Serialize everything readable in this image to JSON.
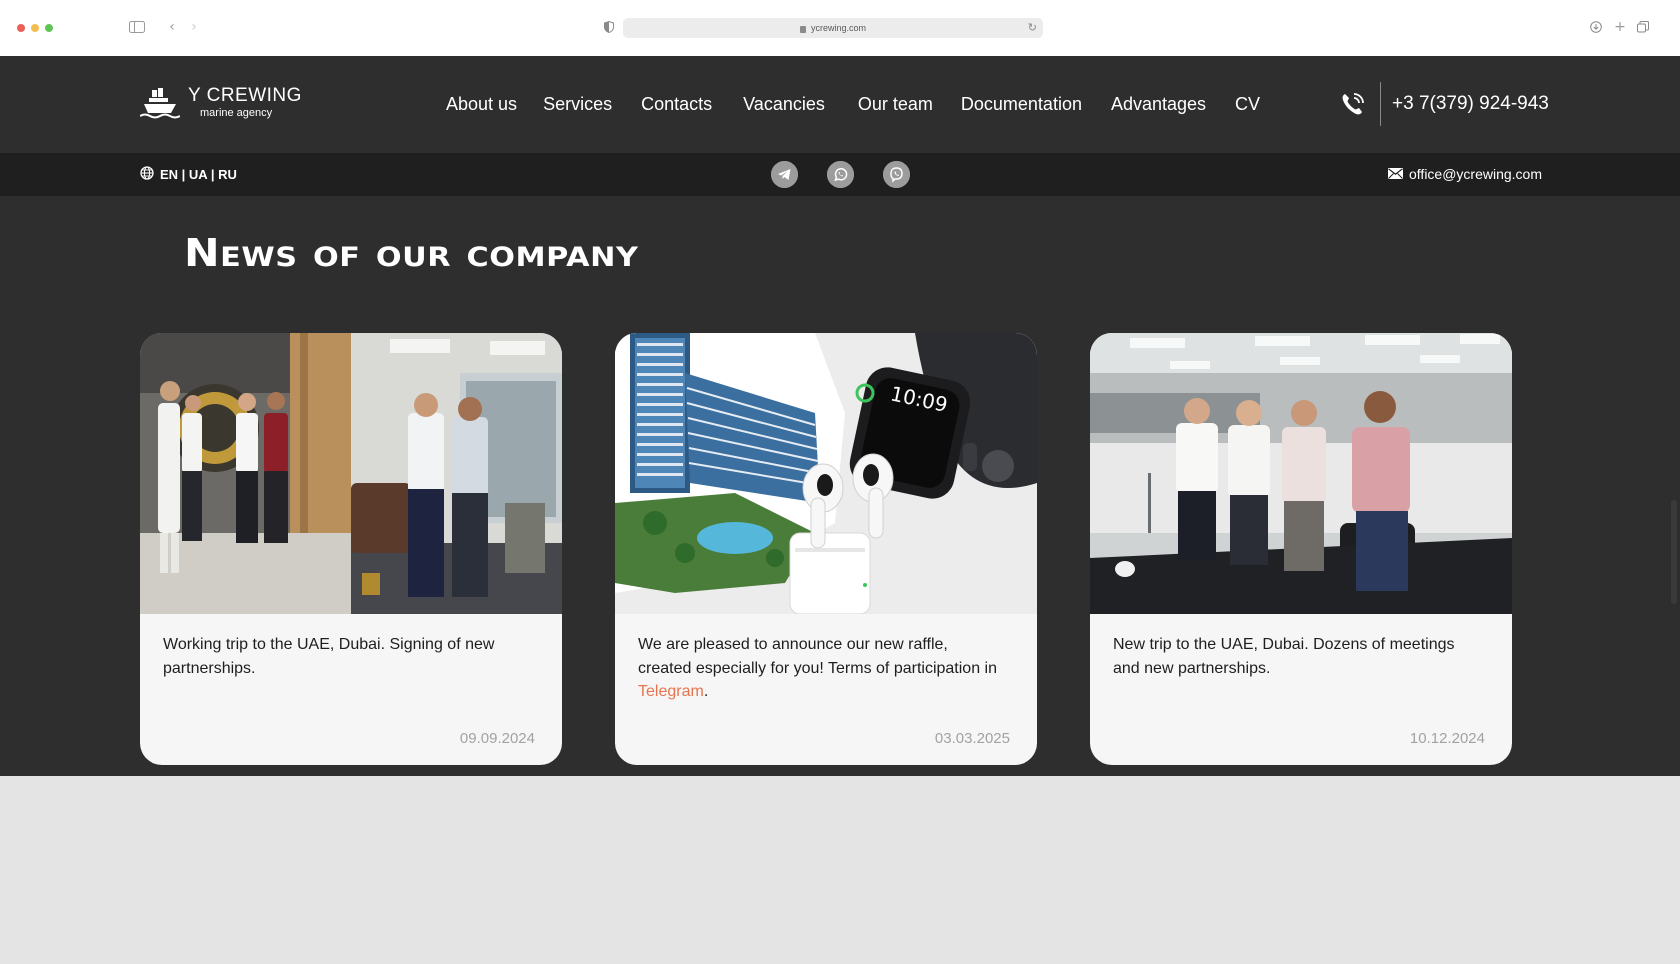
{
  "browser": {
    "url": "ycrewing.com"
  },
  "logo": {
    "title": "Y CREWING",
    "subtitle": "marine agency"
  },
  "nav": {
    "items": [
      {
        "label": "About us"
      },
      {
        "label": "Services"
      },
      {
        "label": "Contacts"
      },
      {
        "label": "Vacancies"
      },
      {
        "label": "Our team"
      },
      {
        "label": "Documentation"
      },
      {
        "label": "Advantages"
      },
      {
        "label": "CV"
      }
    ]
  },
  "contact": {
    "phone": "+3 7(379) 924-943",
    "email": "office@ycrewing.com"
  },
  "languages": {
    "label": "EN | UA | RU"
  },
  "socials": [
    "telegram-icon",
    "whatsapp-icon",
    "viber-icon"
  ],
  "news": {
    "heading": "News of our company",
    "cards": [
      {
        "text": "Working trip to the UAE, Dubai. Signing of new partnerships.",
        "date": "09.09.2024"
      },
      {
        "text_before": "We are pleased to announce our new raffle, created especially for you! Terms of participation in ",
        "link": "Telegram",
        "text_after": ".",
        "date": "03.03.2025"
      },
      {
        "text": "New trip to the UAE, Dubai. Dozens of meetings and new partnerships.",
        "date": "10.12.2024"
      }
    ]
  },
  "colors": {
    "background": "#2e2e2e",
    "subbar": "#1f1f1f",
    "card": "#f6f6f6",
    "link_accent": "#e8744f",
    "date": "#a2a2a2"
  }
}
